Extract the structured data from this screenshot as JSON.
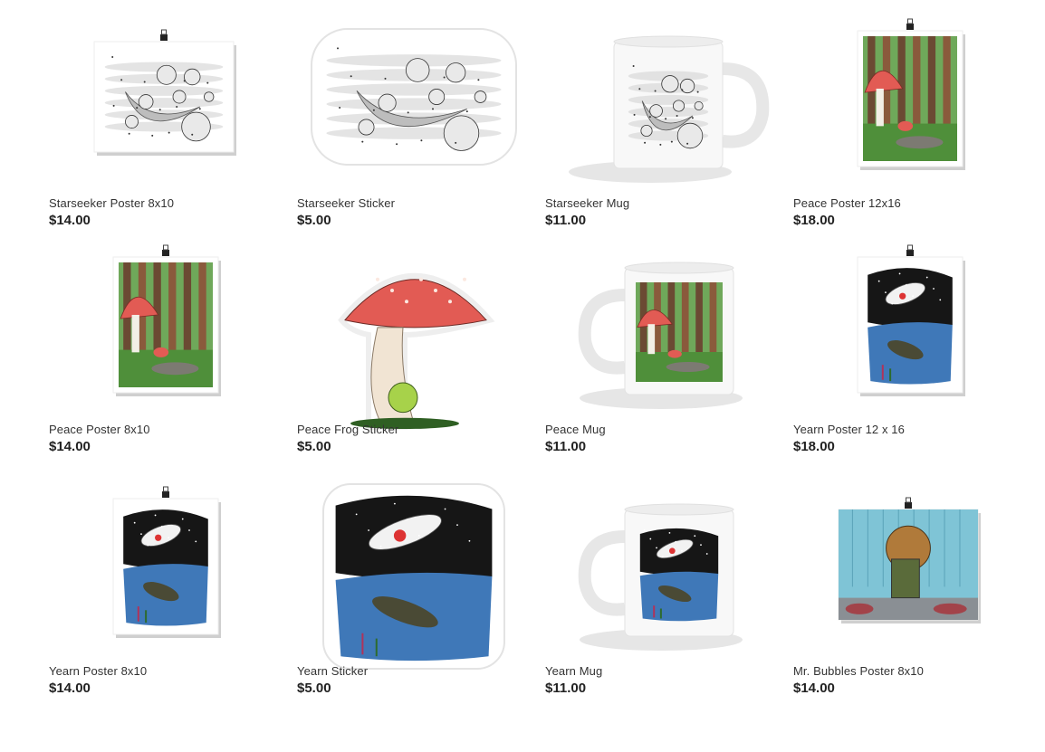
{
  "products": [
    {
      "title": "Starseeker Poster 8x10",
      "price": "$14.00",
      "art": "starseeker",
      "kind": "poster-landscape"
    },
    {
      "title": "Starseeker Sticker",
      "price": "$5.00",
      "art": "starseeker",
      "kind": "sticker"
    },
    {
      "title": "Starseeker Mug",
      "price": "$11.00",
      "art": "starseeker",
      "kind": "mug-right"
    },
    {
      "title": "Peace Poster 12x16",
      "price": "$18.00",
      "art": "peace",
      "kind": "poster-portrait"
    },
    {
      "title": "Peace Poster 8x10",
      "price": "$14.00",
      "art": "peace",
      "kind": "poster-portrait"
    },
    {
      "title": "Peace Frog Sticker",
      "price": "$5.00",
      "art": "mushroom",
      "kind": "sticker-tall"
    },
    {
      "title": "Peace Mug",
      "price": "$11.00",
      "art": "peace",
      "kind": "mug-left"
    },
    {
      "title": "Yearn Poster 12 x 16",
      "price": "$18.00",
      "art": "yearn",
      "kind": "poster-portrait"
    },
    {
      "title": "Yearn Poster 8x10",
      "price": "$14.00",
      "art": "yearn",
      "kind": "poster-portrait"
    },
    {
      "title": "Yearn Sticker",
      "price": "$5.00",
      "art": "yearn",
      "kind": "sticker-tall"
    },
    {
      "title": "Yearn Mug",
      "price": "$11.00",
      "art": "yearn",
      "kind": "mug-left"
    },
    {
      "title": "Mr. Bubbles Poster 8x10",
      "price": "$14.00",
      "art": "bubbles",
      "kind": "poster-landscape"
    }
  ],
  "colors": {
    "text": "#333333",
    "price": "#222222",
    "mushroom_red": "#e25b54",
    "forest_green": "#4f8f3a",
    "bark_brown": "#8a5a3c",
    "space_black": "#161616",
    "water_blue": "#3f78b8",
    "bubbles_teal": "#7fc4d6"
  }
}
